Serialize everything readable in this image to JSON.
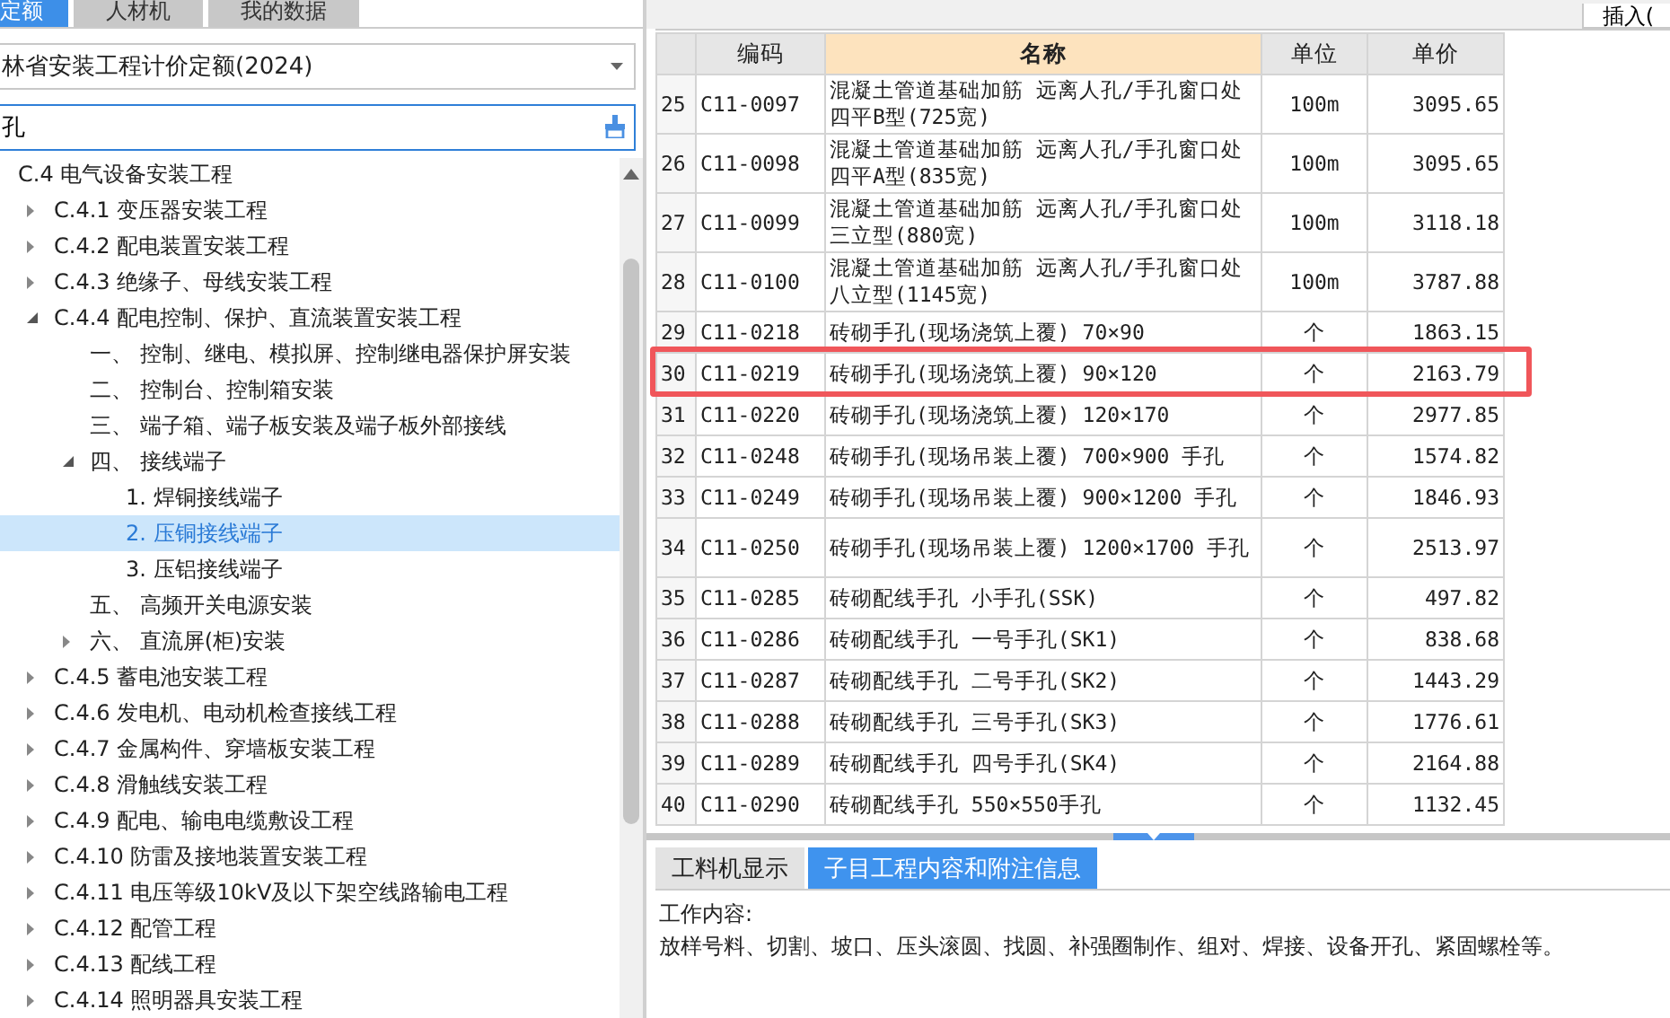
{
  "left_tabs": [
    {
      "label": "定额",
      "selected": true
    },
    {
      "label": "人材机",
      "selected": false
    },
    {
      "label": "我的数据",
      "selected": false
    }
  ],
  "library_select": {
    "value": "林省安装工程计价定额(2024)"
  },
  "search": {
    "value": "孔"
  },
  "tree": [
    {
      "label": "C.4 电气设备安装工程",
      "kind": "root",
      "expanded": true,
      "selected": false,
      "children": [
        {
          "label": "C.4.1 变压器安装工程",
          "kind": "group",
          "expanded": false,
          "selected": false
        },
        {
          "label": "C.4.2 配电装置安装工程",
          "kind": "group",
          "expanded": false,
          "selected": false
        },
        {
          "label": "C.4.3 绝缘子、母线安装工程",
          "kind": "group",
          "expanded": false,
          "selected": false
        },
        {
          "label": "C.4.4 配电控制、保护、直流装置安装工程",
          "kind": "group",
          "expanded": true,
          "selected": false,
          "children": [
            {
              "label": "一、 控制、继电、模拟屏、控制继电器保护屏安装",
              "kind": "leaf",
              "selected": false
            },
            {
              "label": "二、 控制台、控制箱安装",
              "kind": "leaf",
              "selected": false
            },
            {
              "label": "三、 端子箱、端子板安装及端子板外部接线",
              "kind": "leaf",
              "selected": false
            },
            {
              "label": "四、 接线端子",
              "kind": "group",
              "expanded": true,
              "selected": false,
              "children": [
                {
                  "label": "1. 焊铜接线端子",
                  "kind": "leaf",
                  "selected": false
                },
                {
                  "label": "2. 压铜接线端子",
                  "kind": "leaf",
                  "selected": true
                },
                {
                  "label": "3. 压铝接线端子",
                  "kind": "leaf",
                  "selected": false
                }
              ]
            },
            {
              "label": "五、 高频开关电源安装",
              "kind": "leaf",
              "selected": false
            },
            {
              "label": "六、 直流屏(柜)安装",
              "kind": "group",
              "expanded": false,
              "selected": false
            }
          ]
        },
        {
          "label": "C.4.5 蓄电池安装工程",
          "kind": "group",
          "expanded": false,
          "selected": false
        },
        {
          "label": "C.4.6 发电机、电动机检查接线工程",
          "kind": "group",
          "expanded": false,
          "selected": false
        },
        {
          "label": "C.4.7 金属构件、穿墙板安装工程",
          "kind": "group",
          "expanded": false,
          "selected": false
        },
        {
          "label": "C.4.8 滑触线安装工程",
          "kind": "group",
          "expanded": false,
          "selected": false
        },
        {
          "label": "C.4.9 配电、输电电缆敷设工程",
          "kind": "group",
          "expanded": false,
          "selected": false
        },
        {
          "label": "C.4.10 防雷及接地装置安装工程",
          "kind": "group",
          "expanded": false,
          "selected": false
        },
        {
          "label": "C.4.11 电压等级10kV及以下架空线路输电工程",
          "kind": "group",
          "expanded": false,
          "selected": false
        },
        {
          "label": "C.4.12 配管工程",
          "kind": "group",
          "expanded": false,
          "selected": false
        },
        {
          "label": "C.4.13 配线工程",
          "kind": "group",
          "expanded": false,
          "selected": false
        },
        {
          "label": "C.4.14 照明器具安装工程",
          "kind": "group",
          "expanded": false,
          "selected": false
        }
      ]
    }
  ],
  "toolbar": {
    "insert_button": "插入("
  },
  "table": {
    "columns": [
      "编码",
      "名称",
      "单位",
      "单价"
    ],
    "rows": [
      {
        "no": "25",
        "code": "C11-0097",
        "name": "混凝土管道基础加筋 远离人孔/手孔窗口处四平B型(725宽)",
        "unit": "100m",
        "price": "3095.65",
        "highlighted": false
      },
      {
        "no": "26",
        "code": "C11-0098",
        "name": "混凝土管道基础加筋 远离人孔/手孔窗口处四平A型(835宽)",
        "unit": "100m",
        "price": "3095.65",
        "highlighted": false
      },
      {
        "no": "27",
        "code": "C11-0099",
        "name": "混凝土管道基础加筋 远离人孔/手孔窗口处三立型(880宽)",
        "unit": "100m",
        "price": "3118.18",
        "highlighted": false
      },
      {
        "no": "28",
        "code": "C11-0100",
        "name": "混凝土管道基础加筋 远离人孔/手孔窗口处八立型(1145宽)",
        "unit": "100m",
        "price": "3787.88",
        "highlighted": false
      },
      {
        "no": "29",
        "code": "C11-0218",
        "name": "砖砌手孔(现场浇筑上覆) 70×90",
        "unit": "个",
        "price": "1863.15",
        "highlighted": false
      },
      {
        "no": "30",
        "code": "C11-0219",
        "name": "砖砌手孔(现场浇筑上覆) 90×120",
        "unit": "个",
        "price": "2163.79",
        "highlighted": true
      },
      {
        "no": "31",
        "code": "C11-0220",
        "name": "砖砌手孔(现场浇筑上覆) 120×170",
        "unit": "个",
        "price": "2977.85",
        "highlighted": false
      },
      {
        "no": "32",
        "code": "C11-0248",
        "name": "砖砌手孔(现场吊装上覆) 700×900 手孔",
        "unit": "个",
        "price": "1574.82",
        "highlighted": false
      },
      {
        "no": "33",
        "code": "C11-0249",
        "name": "砖砌手孔(现场吊装上覆) 900×1200 手孔",
        "unit": "个",
        "price": "1846.93",
        "highlighted": false
      },
      {
        "no": "34",
        "code": "C11-0250",
        "name": "砖砌手孔(现场吊装上覆) 1200×1700 手孔",
        "unit": "个",
        "price": "2513.97",
        "highlighted": false
      },
      {
        "no": "35",
        "code": "C11-0285",
        "name": "砖砌配线手孔 小手孔(SSK)",
        "unit": "个",
        "price": "497.82",
        "highlighted": false
      },
      {
        "no": "36",
        "code": "C11-0286",
        "name": "砖砌配线手孔 一号手孔(SK1)",
        "unit": "个",
        "price": "838.68",
        "highlighted": false
      },
      {
        "no": "37",
        "code": "C11-0287",
        "name": "砖砌配线手孔 二号手孔(SK2)",
        "unit": "个",
        "price": "1443.29",
        "highlighted": false
      },
      {
        "no": "38",
        "code": "C11-0288",
        "name": "砖砌配线手孔 三号手孔(SK3)",
        "unit": "个",
        "price": "1776.61",
        "highlighted": false
      },
      {
        "no": "39",
        "code": "C11-0289",
        "name": "砖砌配线手孔 四号手孔(SK4)",
        "unit": "个",
        "price": "2164.88",
        "highlighted": false
      },
      {
        "no": "40",
        "code": "C11-0290",
        "name": "砖砌配线手孔 550×550手孔",
        "unit": "个",
        "price": "1132.45",
        "highlighted": false
      }
    ]
  },
  "bottom_tabs": [
    {
      "label": "工料机显示",
      "selected": false
    },
    {
      "label": "子目工程内容和附注信息",
      "selected": true
    }
  ],
  "detail": {
    "heading": "工作内容:",
    "text": "放样号料、切割、坡口、压头滚圆、找圆、补强圈制作、组对、焊接、设备开孔、紧固螺栓等。"
  }
}
